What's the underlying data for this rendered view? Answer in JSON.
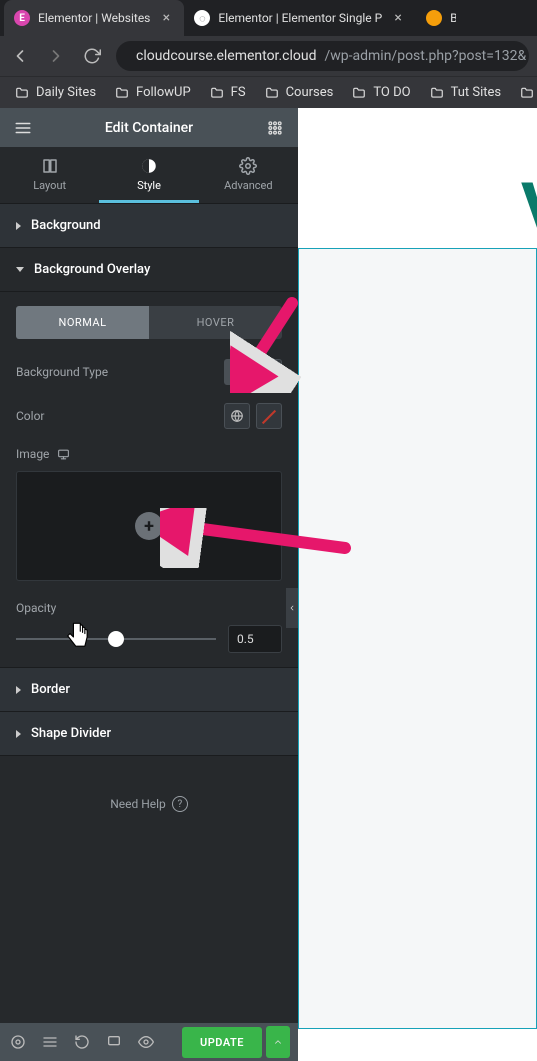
{
  "browser": {
    "tabs": [
      {
        "title": "Elementor | Websites",
        "site": "e"
      },
      {
        "title": "Elementor | Elementor Single P",
        "site": "g"
      },
      {
        "title": "Bik",
        "site": "b"
      }
    ],
    "url_host": "cloudcourse.elementor.cloud",
    "url_path": "/wp-admin/post.php?post=132&",
    "bookmarks": [
      "Daily Sites",
      "FollowUP",
      "FS",
      "Courses",
      "TO DO",
      "Tut Sites"
    ]
  },
  "editor": {
    "title": "Edit Container",
    "tabs": {
      "layout": "Layout",
      "style": "Style",
      "advanced": "Advanced"
    },
    "sections": {
      "background": "Background",
      "bg_overlay": "Background Overlay",
      "border": "Border",
      "shape": "Shape Divider"
    },
    "overlay": {
      "normal": "NORMAL",
      "hover": "HOVER",
      "bg_type_label": "Background Type",
      "color_label": "Color",
      "image_label": "Image",
      "opacity_label": "Opacity",
      "opacity_value": "0.5",
      "opacity_percent": 50
    },
    "help": "Need Help",
    "update": "UPDATE"
  },
  "icons": {
    "hamburger": "hamburger-icon",
    "apps": "apps-icon",
    "back": "back-icon",
    "forward": "forward-icon",
    "reload": "reload-icon",
    "lock": "lock-icon",
    "folder": "folder-icon",
    "close": "close-icon"
  },
  "colors": {
    "accent": "#5bc0de",
    "update": "#39b54a",
    "selection": "#17a2b8",
    "arrow": "#e6176b"
  }
}
